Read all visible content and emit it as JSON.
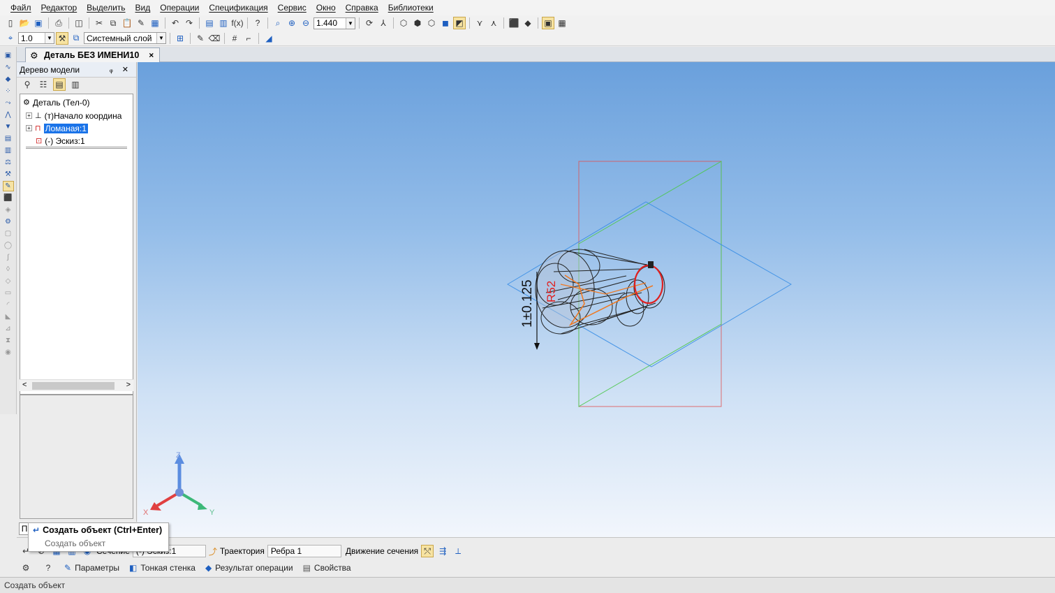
{
  "menu": [
    "Файл",
    "Редактор",
    "Выделить",
    "Вид",
    "Операции",
    "Спецификация",
    "Сервис",
    "Окно",
    "Справка",
    "Библиотеки"
  ],
  "toolbar1": {
    "zoom_value": "1.440"
  },
  "toolbar2": {
    "line_width_value": "1.0",
    "layer_value": "Системный слой"
  },
  "document_tab": {
    "title": "Деталь БЕЗ ИМЕНИ10",
    "close": "×"
  },
  "tree": {
    "header": "Дерево модели",
    "header_buttons": "ᵩ ✕",
    "nodes": [
      {
        "label": "Деталь (Тел-0)"
      },
      {
        "label": "(т)Начало координа"
      },
      {
        "label": "Ломаная:1"
      },
      {
        "label": "(-) Эскиз:1"
      }
    ],
    "scroll_left": "<",
    "scroll_right": ">"
  },
  "viewport": {
    "dimension_label": "1±0.125",
    "dimension_label_red": "R52",
    "axis_labels": {
      "z": "Z",
      "x": "X",
      "y": "Y"
    },
    "colors": {
      "plane_red": "#e05050",
      "plane_green": "#4cc84c",
      "plane_blue": "#3a8ee6",
      "axis_z": "#5b8de0",
      "axis_x": "#e04040",
      "axis_y": "#3cb878",
      "sketch_red": "#e02020",
      "path_orange": "#f07820"
    }
  },
  "propbar": {
    "section_label": "Сечение",
    "section_value": "(-) Эскиз:1",
    "trajectory_label": "Траектория",
    "trajectory_value": "Ребра 1",
    "motion_label": "Движение сечения",
    "tabs": [
      {
        "label": "Параметры"
      },
      {
        "label": "Тонкая стенка"
      },
      {
        "label": "Результат операции"
      },
      {
        "label": "Свойства"
      }
    ]
  },
  "tooltip": {
    "title": "Создать объект (Ctrl+Enter)",
    "subtitle": "Создать объект",
    "tiny_label": "П"
  },
  "status": {
    "text": "Создать объект"
  }
}
